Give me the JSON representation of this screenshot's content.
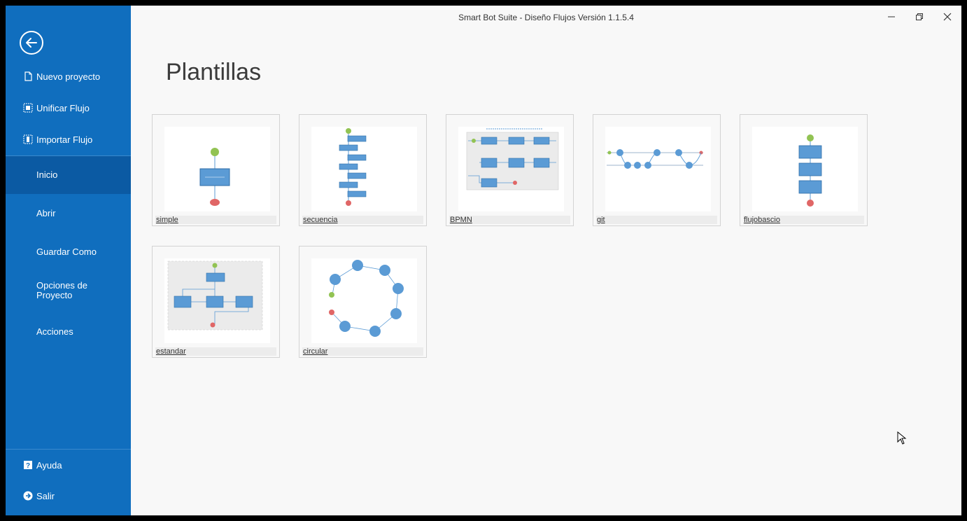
{
  "window": {
    "title": "Smart Bot Suite - Diseño Flujos Versión 1.1.5.4"
  },
  "sidebar": {
    "commands": [
      {
        "label": "Nuevo proyecto",
        "icon": "new-document-icon"
      },
      {
        "label": "Unificar Flujo",
        "icon": "unify-flow-icon"
      },
      {
        "label": "Importar Flujo",
        "icon": "import-flow-icon"
      }
    ],
    "nav": [
      {
        "label": "Inicio",
        "active": true
      },
      {
        "label": "Abrir"
      },
      {
        "label": "Guardar Como"
      },
      {
        "label": "Opciones de Proyecto"
      },
      {
        "label": "Acciones"
      }
    ],
    "footer": [
      {
        "label": "Ayuda",
        "icon": "help-icon"
      },
      {
        "label": "Salir",
        "icon": "exit-icon"
      }
    ]
  },
  "main": {
    "title": "Plantillas",
    "templates": [
      {
        "label": "simple"
      },
      {
        "label": "secuencia"
      },
      {
        "label": "BPMN"
      },
      {
        "label": "git"
      },
      {
        "label": "flujobascio"
      },
      {
        "label": "estandar"
      },
      {
        "label": "circular"
      }
    ]
  },
  "colors": {
    "sidebar": "#106ebe",
    "sidebar_active": "#0b5aa3",
    "node_blue": "#5b9bd5",
    "start_green": "#92c353",
    "end_red": "#e06666"
  }
}
